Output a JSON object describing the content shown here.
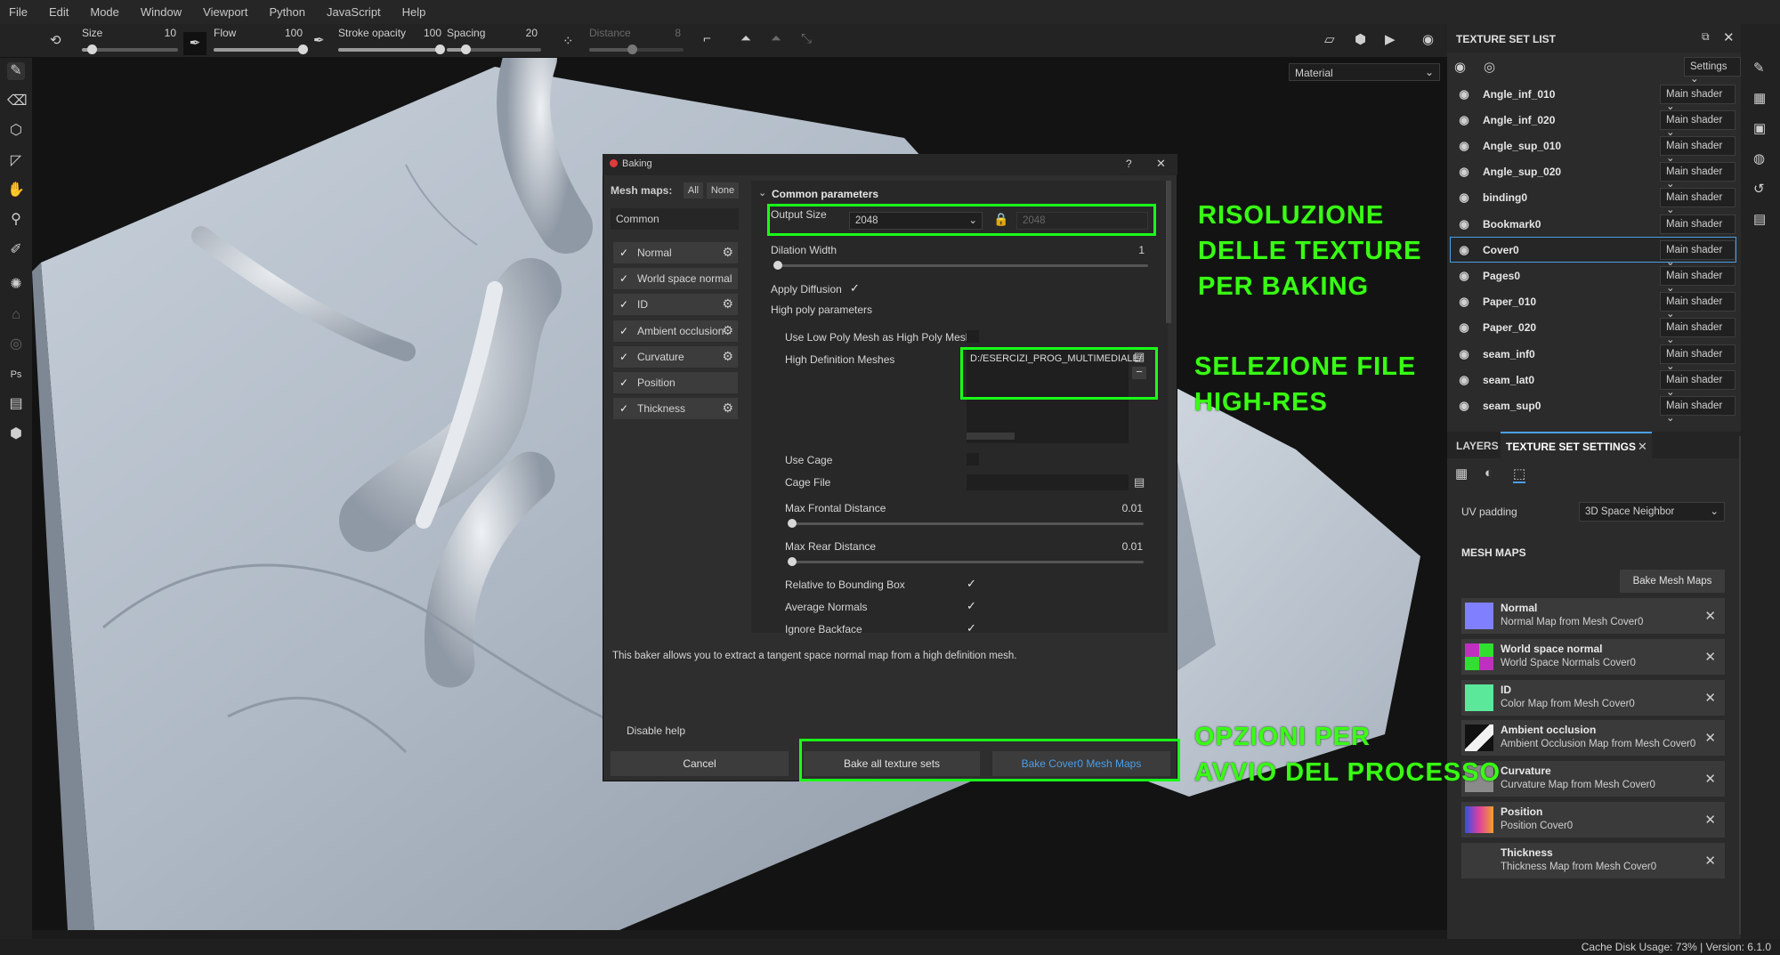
{
  "menu": [
    "File",
    "Edit",
    "Mode",
    "Window",
    "Viewport",
    "Python",
    "JavaScript",
    "Help"
  ],
  "tool_props": {
    "size_label": "Size",
    "size_value": "10",
    "flow_label": "Flow",
    "flow_value": "100",
    "stroke_opacity_label": "Stroke opacity",
    "stroke_opacity_value": "100",
    "spacing_label": "Spacing",
    "spacing_value": "20",
    "distance_label": "Distance",
    "distance_value": "8",
    "size_level": 0.1,
    "flow_level": 1.0,
    "stroke_opacity_level": 1.0,
    "spacing_level": 0.2,
    "distance_level": 0.45
  },
  "viewport": {
    "material_select": "Material"
  },
  "texture_set_list": {
    "title": "TEXTURE SET LIST",
    "settings_label": "Settings",
    "items": [
      {
        "name": "Angle_inf_010",
        "shader": "Main shader"
      },
      {
        "name": "Angle_inf_020",
        "shader": "Main shader"
      },
      {
        "name": "Angle_sup_010",
        "shader": "Main shader"
      },
      {
        "name": "Angle_sup_020",
        "shader": "Main shader"
      },
      {
        "name": "binding0",
        "shader": "Main shader"
      },
      {
        "name": "Bookmark0",
        "shader": "Main shader"
      },
      {
        "name": "Cover0",
        "shader": "Main shader"
      },
      {
        "name": "Pages0",
        "shader": "Main shader"
      },
      {
        "name": "Paper_010",
        "shader": "Main shader"
      },
      {
        "name": "Paper_020",
        "shader": "Main shader"
      },
      {
        "name": "seam_inf0",
        "shader": "Main shader"
      },
      {
        "name": "seam_lat0",
        "shader": "Main shader"
      },
      {
        "name": "seam_sup0",
        "shader": "Main shader"
      }
    ],
    "selected": "Cover0"
  },
  "settings_panel": {
    "tab_layers": "LAYERS",
    "tab_tss": "TEXTURE SET SETTINGS",
    "uv_padding_label": "UV padding",
    "uv_padding_value": "3D Space Neighbor",
    "mesh_maps_title": "MESH MAPS",
    "bake_button": "Bake Mesh Maps",
    "mesh_maps": [
      {
        "name": "Normal",
        "source": "Normal Map from Mesh Cover0",
        "thumb": "normal"
      },
      {
        "name": "World space normal",
        "source": "World Space Normals Cover0",
        "thumb": "world"
      },
      {
        "name": "ID",
        "source": "Color Map from Mesh Cover0",
        "thumb": "id"
      },
      {
        "name": "Ambient occlusion",
        "source": "Ambient Occlusion Map from Mesh Cover0",
        "thumb": "ao"
      },
      {
        "name": "Curvature",
        "source": "Curvature Map from Mesh Cover0",
        "thumb": "curv"
      },
      {
        "name": "Position",
        "source": "Position Cover0",
        "thumb": "pos"
      },
      {
        "name": "Thickness",
        "source": "Thickness Map from Mesh Cover0",
        "thumb": "thick"
      }
    ]
  },
  "baking_dialog": {
    "title": "Baking",
    "help_icon": "?",
    "mesh_maps_label": "Mesh maps:",
    "all_label": "All",
    "none_label": "None",
    "common_label": "Common",
    "maps": [
      "Normal",
      "World space normal",
      "ID",
      "Ambient occlusion",
      "Curvature",
      "Position",
      "Thickness"
    ],
    "section_title": "Common parameters",
    "output_size_label": "Output Size",
    "output_size_value": "2048",
    "output_size_linked": "2048",
    "dilation_label": "Dilation Width",
    "dilation_value": "1",
    "apply_diffusion_label": "Apply Diffusion",
    "high_poly_label": "High poly parameters",
    "use_low_poly_label": "Use Low Poly Mesh as High Poly Mesh",
    "hd_meshes_label": "High Definition Meshes",
    "hd_mesh_path": "D:/ESERCIZI_PROG_MULTIMEDIALE/",
    "use_cage_label": "Use Cage",
    "cage_file_label": "Cage File",
    "max_frontal_label": "Max Frontal Distance",
    "max_frontal_value": "0.01",
    "max_rear_label": "Max Rear Distance",
    "max_rear_value": "0.01",
    "relative_bbox_label": "Relative to Bounding Box",
    "average_normals_label": "Average Normals",
    "ignore_backface_label": "Ignore Backface",
    "help_text": "This baker allows you to extract a tangent space normal map from a high definition mesh.",
    "disable_help": "Disable help",
    "cancel": "Cancel",
    "bake_all": "Bake all texture sets",
    "bake_cover": "Bake Cover0 Mesh Maps"
  },
  "annotations": {
    "resolution": [
      "RISOLUZIONE",
      "DELLE TEXTURE",
      "PER BAKING"
    ],
    "file": [
      "SELEZIONE FILE",
      "HIGH-RES"
    ],
    "options": [
      "OPZIONI PER",
      "AVVIO DEL PROCESSO"
    ]
  },
  "status": "Cache Disk Usage: 73% | Version: 6.1.0",
  "colors": {
    "annotation": "#39ff14",
    "accent_blue": "#4a9ee8"
  }
}
